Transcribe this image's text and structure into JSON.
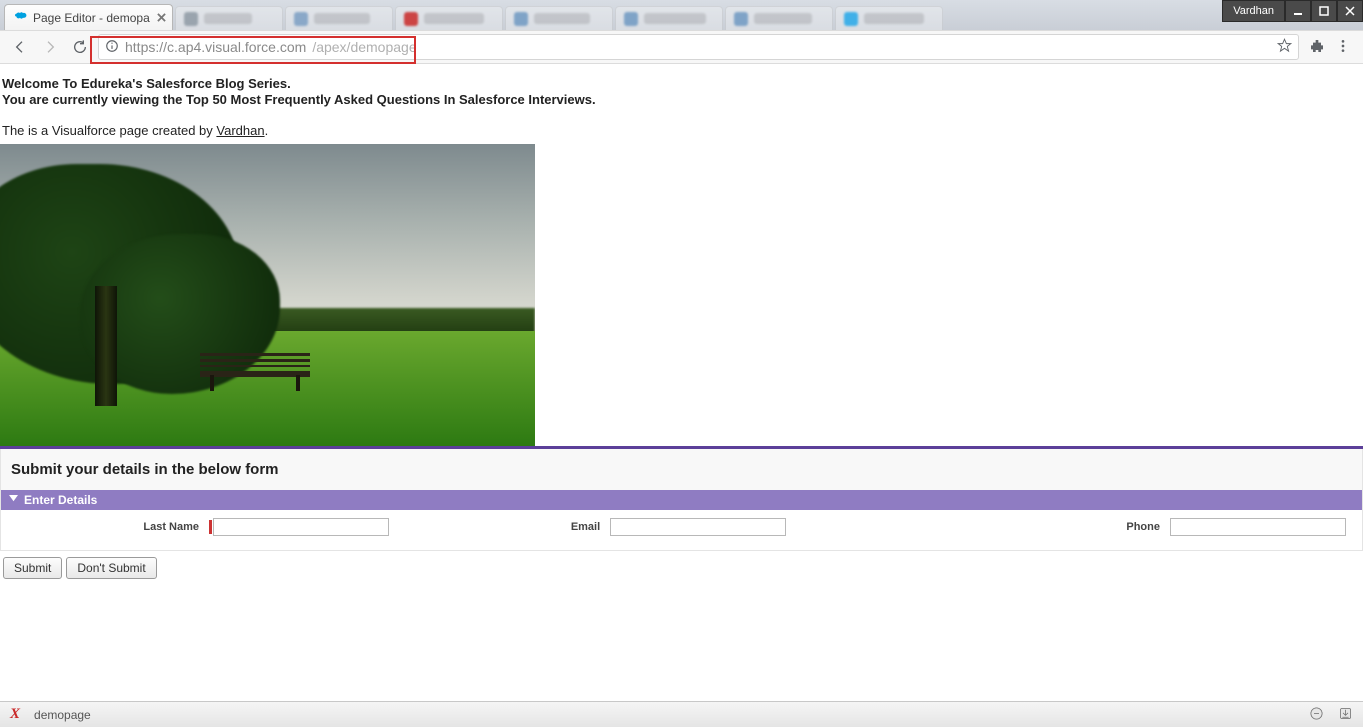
{
  "os": {
    "user": "Vardhan"
  },
  "browser": {
    "tab_title": "Page Editor - demopa",
    "url_a": "https://c.ap4.visual.force.com",
    "url_b": "/apex/demopage"
  },
  "page": {
    "heading1": "Welcome To Edureka's Salesforce Blog Series.",
    "heading2": "You are currently viewing the Top 50 Most Frequently Asked Questions In Salesforce Interviews.",
    "desc_prefix": "The is a Visualforce page created by ",
    "desc_link": "Vardhan",
    "desc_suffix": "."
  },
  "form": {
    "block_title": "Submit your details in the below form",
    "section_title": "Enter Details",
    "fields": {
      "last_name": {
        "label": "Last Name",
        "value": ""
      },
      "email": {
        "label": "Email",
        "value": ""
      },
      "phone": {
        "label": "Phone",
        "value": ""
      }
    },
    "buttons": {
      "submit": "Submit",
      "cancel": "Don't Submit"
    }
  },
  "devbar": {
    "page_name": "demopage"
  }
}
